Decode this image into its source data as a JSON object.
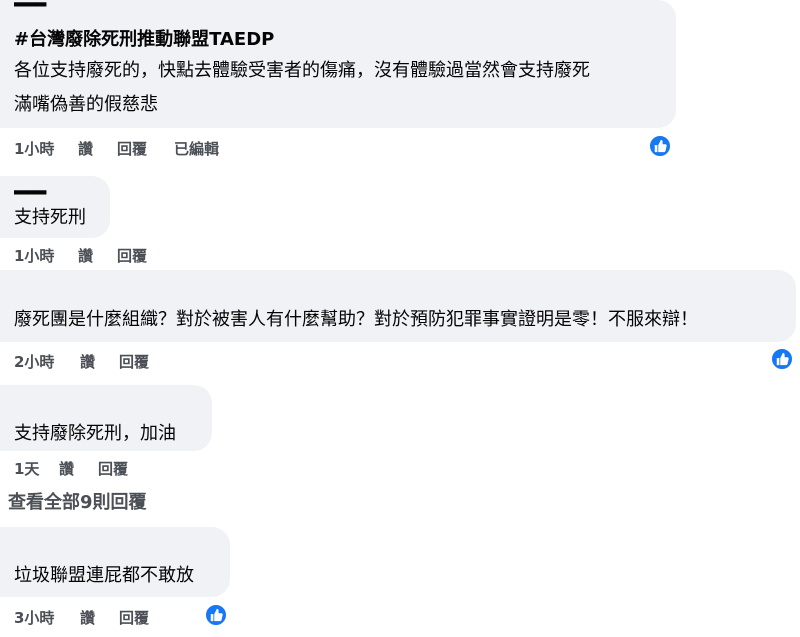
{
  "comments": [
    {
      "hashtag": "#台灣廢除死刑推動聯盟TAEDP",
      "lines": [
        "各位支持廢死的，快點去體驗受害者的傷痛，沒有體驗過當然會支持廢死",
        "滿嘴偽善的假慈悲"
      ],
      "time": "1小時",
      "like_label": "讚",
      "reply_label": "回覆",
      "edited_label": "已編輯"
    },
    {
      "lines": [
        "支持死刑"
      ],
      "time": "1小時",
      "like_label": "讚",
      "reply_label": "回覆"
    },
    {
      "lines": [
        "廢死團是什麼組織？對於被害人有什麼幫助？對於預防犯罪事實證明是零！不服來辯！"
      ],
      "time": "2小時",
      "like_label": "讚",
      "reply_label": "回覆"
    },
    {
      "lines": [
        "支持廢除死刑，加油"
      ],
      "time": "1天",
      "like_label": "讚",
      "reply_label": "回覆"
    },
    {
      "lines": [
        "垃圾聯盟連屁都不敢放"
      ],
      "time": "3小時",
      "like_label": "讚",
      "reply_label": "回覆"
    }
  ],
  "view_all_replies": "查看全部9則回覆",
  "colors": {
    "bubble": "#f0f2f5",
    "like_badge": "#1877f2",
    "meta_text": "#4b4f56"
  },
  "icons": {
    "reaction": "thumbs-up-icon"
  }
}
